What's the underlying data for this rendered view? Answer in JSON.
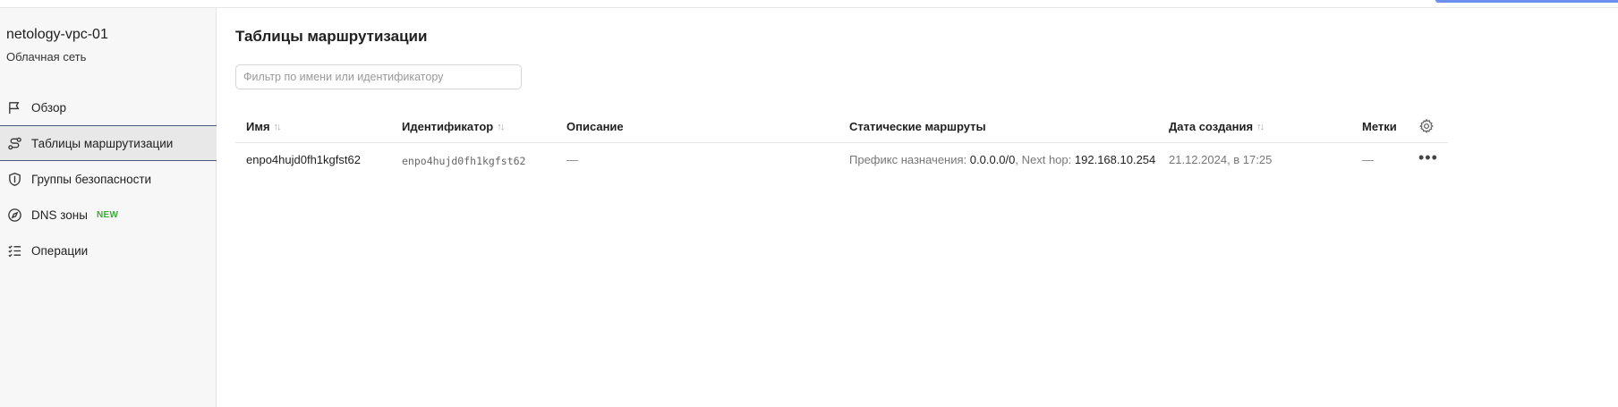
{
  "sidebar": {
    "title": "netology-vpc-01",
    "subtitle": "Облачная сеть",
    "items": [
      {
        "label": "Обзор",
        "icon": "flag-icon"
      },
      {
        "label": "Таблицы маршрутизации",
        "icon": "route-icon",
        "active": true
      },
      {
        "label": "Группы безопасности",
        "icon": "shield-icon"
      },
      {
        "label": "DNS зоны",
        "icon": "compass-icon",
        "badge": "NEW"
      },
      {
        "label": "Операции",
        "icon": "checklist-icon"
      }
    ]
  },
  "main": {
    "title": "Таблицы маршрутизации",
    "filter_placeholder": "Фильтр по имени или идентификатору"
  },
  "table": {
    "columns": {
      "name": "Имя",
      "id": "Идентификатор",
      "description": "Описание",
      "routes": "Статические маршруты",
      "created": "Дата создания",
      "labels": "Метки"
    },
    "rows": [
      {
        "name": "enpo4hujd0fh1kgfst62",
        "id": "enpo4hujd0fh1kgfst62",
        "description": "—",
        "route_prefix_label": "Префикс назначения:",
        "route_prefix": "0.0.0.0/0",
        "route_nexthop_label": ", Next hop:",
        "route_nexthop": "192.168.10.254",
        "created": "21.12.2024, в 17:25",
        "labels": "—"
      }
    ]
  },
  "colors": {
    "accent": "#6b8ef0",
    "new_badge": "#3fa83f",
    "active_border": "#4a5a7a"
  }
}
